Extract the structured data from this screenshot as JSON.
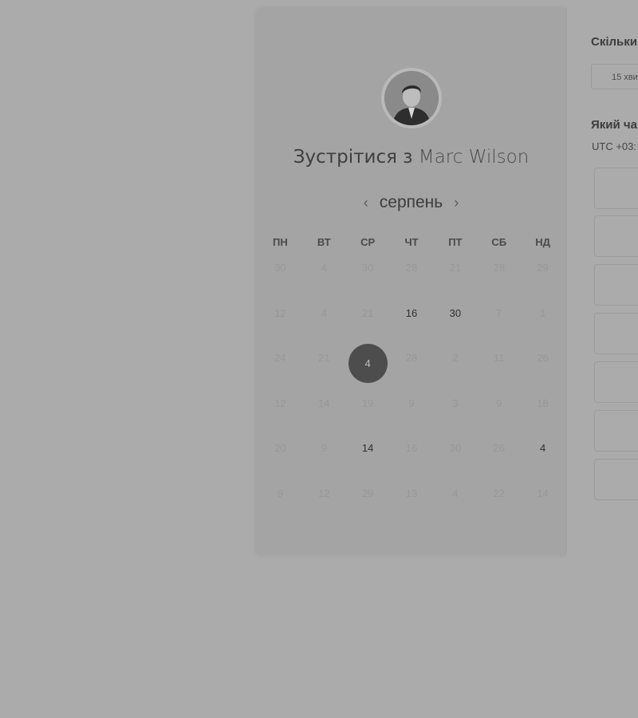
{
  "calendar": {
    "title_prefix": "Зустрітися з",
    "host_name": "Marc Wilson",
    "month": "серпень",
    "prev_icon": "chevron-left-icon",
    "next_icon": "chevron-right-icon",
    "weekdays": [
      "ПН",
      "ВТ",
      "СР",
      "ЧТ",
      "ПТ",
      "СБ",
      "НД"
    ],
    "weeks": [
      [
        {
          "d": "30",
          "a": false
        },
        {
          "d": "4",
          "a": false
        },
        {
          "d": "30",
          "a": false
        },
        {
          "d": "28",
          "a": false
        },
        {
          "d": "21",
          "a": false
        },
        {
          "d": "28",
          "a": false
        },
        {
          "d": "29",
          "a": false
        }
      ],
      [
        {
          "d": "12",
          "a": false
        },
        {
          "d": "4",
          "a": false
        },
        {
          "d": "21",
          "a": false
        },
        {
          "d": "16",
          "a": true
        },
        {
          "d": "30",
          "a": true
        },
        {
          "d": "7",
          "a": false
        },
        {
          "d": "1",
          "a": false
        }
      ],
      [
        {
          "d": "24",
          "a": false
        },
        {
          "d": "21",
          "a": false
        },
        {
          "d": "4",
          "a": true,
          "selected": true
        },
        {
          "d": "28",
          "a": false
        },
        {
          "d": "2",
          "a": false
        },
        {
          "d": "11",
          "a": false
        },
        {
          "d": "26",
          "a": false
        }
      ],
      [
        {
          "d": "12",
          "a": false
        },
        {
          "d": "14",
          "a": false
        },
        {
          "d": "19",
          "a": false
        },
        {
          "d": "9",
          "a": false
        },
        {
          "d": "3",
          "a": false
        },
        {
          "d": "9",
          "a": false
        },
        {
          "d": "18",
          "a": false
        }
      ],
      [
        {
          "d": "20",
          "a": false
        },
        {
          "d": "9",
          "a": false
        },
        {
          "d": "14",
          "a": true
        },
        {
          "d": "16",
          "a": false
        },
        {
          "d": "30",
          "a": false
        },
        {
          "d": "26",
          "a": false
        },
        {
          "d": "4",
          "a": true
        }
      ],
      [
        {
          "d": "9",
          "a": false
        },
        {
          "d": "12",
          "a": false
        },
        {
          "d": "29",
          "a": false
        },
        {
          "d": "13",
          "a": false
        },
        {
          "d": "4",
          "a": false
        },
        {
          "d": "22",
          "a": false
        },
        {
          "d": "14",
          "a": false
        }
      ]
    ]
  },
  "details": {
    "duration_question": "Скільки",
    "duration_value": "15 хви",
    "time_question": "Який ча",
    "timezone": "UTC +03:",
    "slot_count": 7
  }
}
